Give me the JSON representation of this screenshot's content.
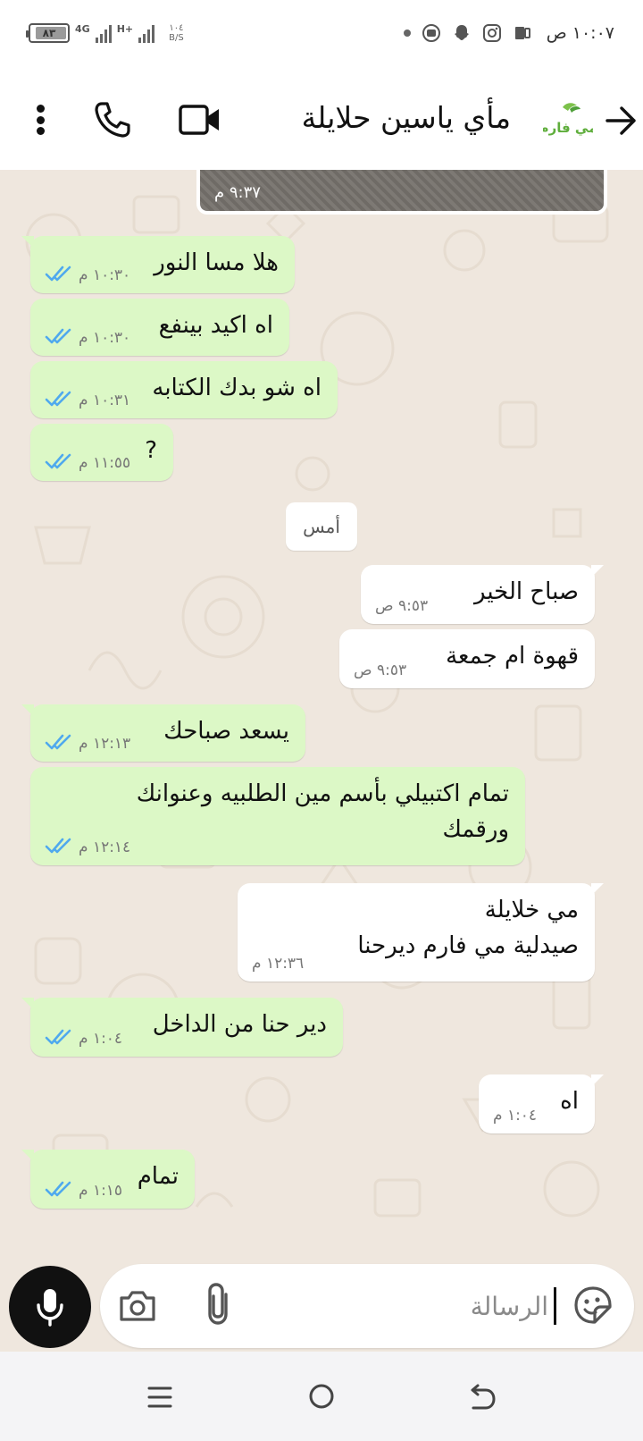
{
  "status_bar": {
    "battery": "٨٣",
    "network_type": "4G",
    "network_type_2": "H+",
    "speed_value": "١٠٤",
    "speed_unit": "B/S",
    "time": "١٠:٠٧ ص"
  },
  "header": {
    "contact_name": "مأي ياسين حلايلة",
    "logo_text": "مي فارم"
  },
  "image_message": {
    "time": "٩:٣٧ م"
  },
  "day_separator": "أمس",
  "messages": [
    {
      "dir": "out",
      "text": "هلا مسا النور",
      "time": "١٠:٣٠ م"
    },
    {
      "dir": "out",
      "text": "اه اكيد بينفع",
      "time": "١٠:٣٠ م"
    },
    {
      "dir": "out",
      "text": "اه شو بدك الكتابه",
      "time": "١٠:٣١ م"
    },
    {
      "dir": "out",
      "text": "?",
      "time": "١١:٥٥ م"
    },
    {
      "dir": "in",
      "text": "صباح الخير",
      "time": "٩:٥٣ ص"
    },
    {
      "dir": "in",
      "text": "قهوة ام جمعة",
      "time": "٩:٥٣ ص"
    },
    {
      "dir": "out",
      "text": "يسعد صباحك",
      "time": "١٢:١٣ م"
    },
    {
      "dir": "out",
      "text": "تمام اكتبيلي بأسم مين الطلبيه وعنوانك\nورقمك",
      "time": "١٢:١٤ م"
    },
    {
      "dir": "in",
      "text": "مي خلايلة\nصيدلية مي فارم ديرحنا",
      "time": "١٢:٣٦ م"
    },
    {
      "dir": "out",
      "text": "دير حنا من الداخل",
      "time": "١:٠٤ م"
    },
    {
      "dir": "in",
      "text": "اه",
      "time": "١:٠٤ م"
    },
    {
      "dir": "out",
      "text": "تمام",
      "time": "١:١٥ م"
    }
  ],
  "composer": {
    "placeholder": "الرسالة"
  },
  "colors": {
    "outgoing_bubble": "#dcf8c6",
    "incoming_bubble": "#ffffff",
    "read_ticks": "#4fa9ee",
    "chat_background": "#efe7de"
  },
  "icons": {
    "header": [
      "more-vert-icon",
      "phone-icon",
      "video-call-icon",
      "back-arrow-icon"
    ],
    "composer": [
      "mic-icon",
      "camera-icon",
      "attach-icon",
      "sticker-icon"
    ],
    "nav": [
      "recent-apps-icon",
      "home-icon",
      "back-icon"
    ]
  }
}
